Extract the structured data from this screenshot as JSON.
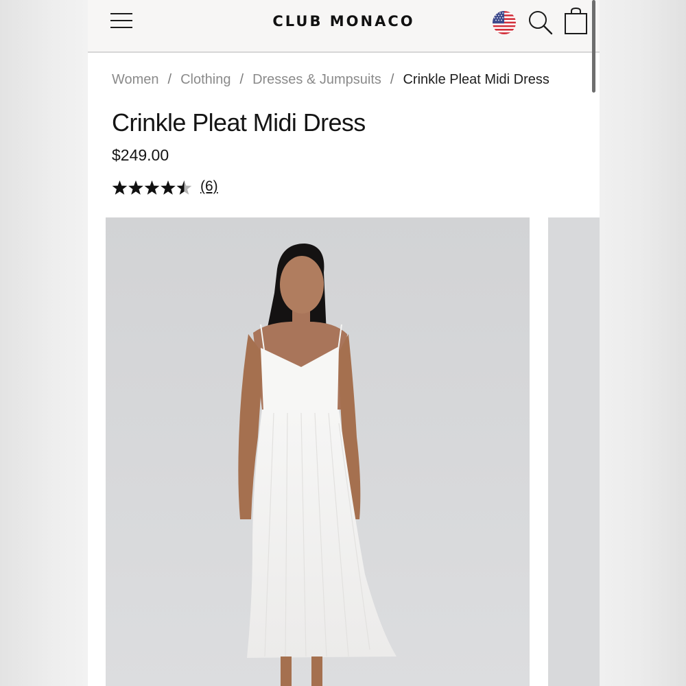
{
  "header": {
    "brand": "CLUB MONACO",
    "icons": {
      "menu": "hamburger-menu-icon",
      "locale": "us-flag-icon",
      "search": "search-icon",
      "bag": "shopping-bag-icon"
    }
  },
  "breadcrumb": {
    "items": [
      "Women",
      "Clothing",
      "Dresses & Jumpsuits"
    ],
    "separator": "/",
    "current": "Crinkle Pleat Midi Dress"
  },
  "product": {
    "title": "Crinkle Pleat Midi Dress",
    "price": "$249.00",
    "rating": {
      "value": 4.5,
      "max": 5,
      "count_label": "(6)"
    }
  },
  "colors": {
    "header_bg": "#f7f6f5",
    "image_bg": "#d7d8da",
    "text": "#141414",
    "breadcrumb": "#8a8a8a"
  }
}
